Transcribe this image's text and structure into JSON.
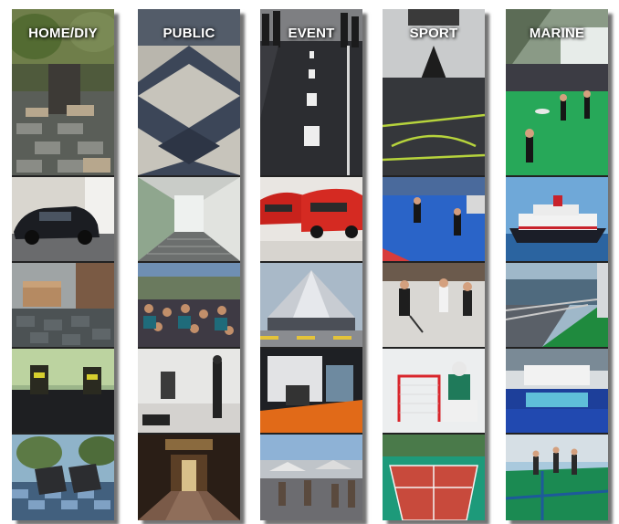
{
  "categories": [
    {
      "id": "home-diy",
      "title": "HOME/DIY"
    },
    {
      "id": "public",
      "title": "PUBLIC"
    },
    {
      "id": "event",
      "title": "EVENT"
    },
    {
      "id": "sport",
      "title": "SPORT"
    },
    {
      "id": "marine",
      "title": "MARINE"
    }
  ]
}
